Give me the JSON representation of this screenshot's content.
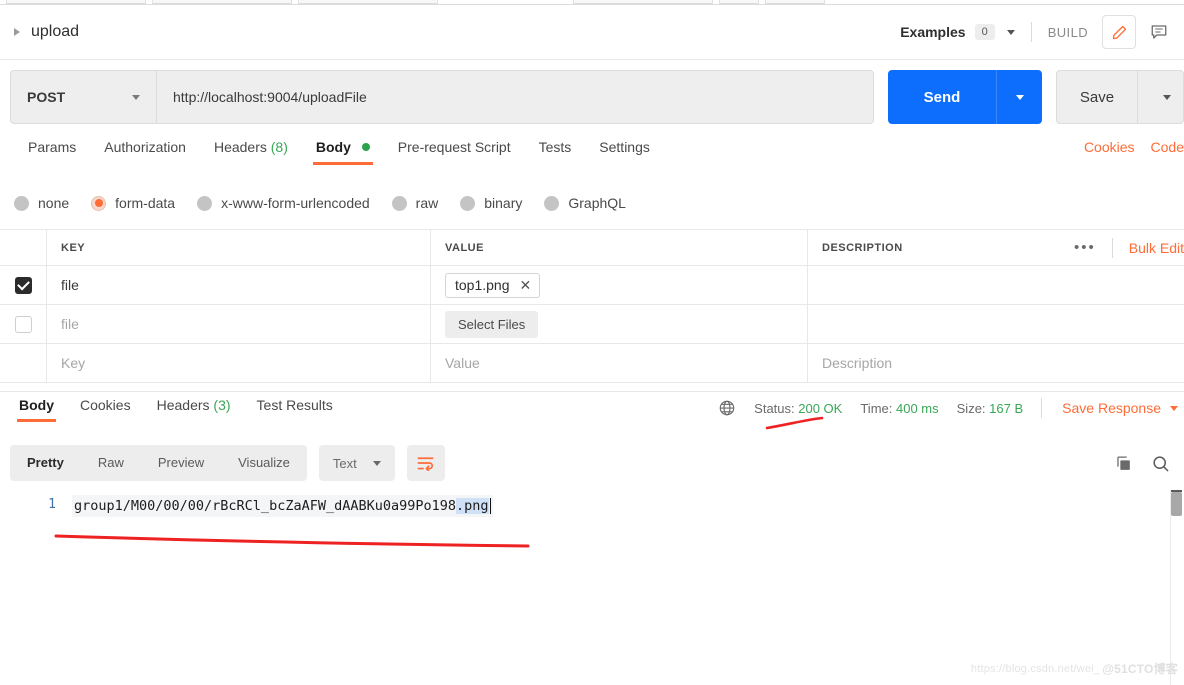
{
  "breadcrumb": {
    "expand_icon": "triangle-right-icon",
    "label": "upload"
  },
  "header": {
    "examples_label": "Examples",
    "examples_count": "0",
    "build_label": "BUILD",
    "edit_icon": "pencil-icon",
    "comment_icon": "comment-icon"
  },
  "request": {
    "method": "POST",
    "url": "http://localhost:9004/uploadFile",
    "send_label": "Send",
    "save_label": "Save"
  },
  "request_tabs": [
    {
      "label": "Params",
      "active": false
    },
    {
      "label": "Authorization",
      "active": false
    },
    {
      "label": "Headers",
      "count": "(8)",
      "active": false
    },
    {
      "label": "Body",
      "active": true,
      "dot": true
    },
    {
      "label": "Pre-request Script",
      "active": false
    },
    {
      "label": "Tests",
      "active": false
    },
    {
      "label": "Settings",
      "active": false
    }
  ],
  "request_tabs_right": [
    {
      "label": "Cookies"
    },
    {
      "label": "Code"
    }
  ],
  "body_types": [
    {
      "label": "none",
      "selected": false
    },
    {
      "label": "form-data",
      "selected": true
    },
    {
      "label": "x-www-form-urlencoded",
      "selected": false
    },
    {
      "label": "raw",
      "selected": false
    },
    {
      "label": "binary",
      "selected": false
    },
    {
      "label": "GraphQL",
      "selected": false
    }
  ],
  "form_table": {
    "headers": {
      "key": "KEY",
      "value": "VALUE",
      "description": "DESCRIPTION"
    },
    "more_icon": "ellipsis-icon",
    "bulk_edit_label": "Bulk Edit",
    "rows": [
      {
        "checked": true,
        "key": "file",
        "value_type": "file-chip",
        "value": "top1.png",
        "remove_icon": "close-icon",
        "description": ""
      },
      {
        "checked": false,
        "key": "file",
        "value_type": "select-files",
        "value": "Select Files",
        "description": ""
      },
      {
        "checked": null,
        "key": "Key",
        "value_type": "placeholder",
        "value": "Value",
        "description": "Description"
      }
    ]
  },
  "response_tabs": [
    {
      "label": "Body",
      "active": true
    },
    {
      "label": "Cookies",
      "active": false
    },
    {
      "label": "Headers",
      "count": "(3)",
      "active": false
    },
    {
      "label": "Test Results",
      "active": false
    }
  ],
  "response_meta": {
    "globe_icon": "globe-icon",
    "status_label": "Status:",
    "status_value": "200 OK",
    "time_label": "Time:",
    "time_value": "400 ms",
    "size_label": "Size:",
    "size_value": "167 B",
    "save_response_label": "Save Response"
  },
  "viewer": {
    "segments": [
      {
        "label": "Pretty",
        "active": true
      },
      {
        "label": "Raw",
        "active": false
      },
      {
        "label": "Preview",
        "active": false
      },
      {
        "label": "Visualize",
        "active": false
      }
    ],
    "format_value": "Text",
    "wrap_icon": "word-wrap-icon",
    "copy_icon": "copy-icon",
    "search_icon": "search-icon"
  },
  "response_body": {
    "line_number": "1",
    "text_plain": "group1/M00/00/00/rBcRCl_bcZaAFW_dAABKu0a99Po198",
    "text_selected": ".png"
  },
  "annotations": {
    "status_underline": "red-hand-drawn-underline",
    "body_underline": "red-hand-drawn-underline"
  },
  "watermark": {
    "url": "https://blog.csdn.net/wei_",
    "brand": "@51CTO博客"
  },
  "colors": {
    "accent": "#ff6c37",
    "send_blue": "#0d6efd",
    "green": "#3aa757",
    "annotation_red": "#ee2222"
  }
}
